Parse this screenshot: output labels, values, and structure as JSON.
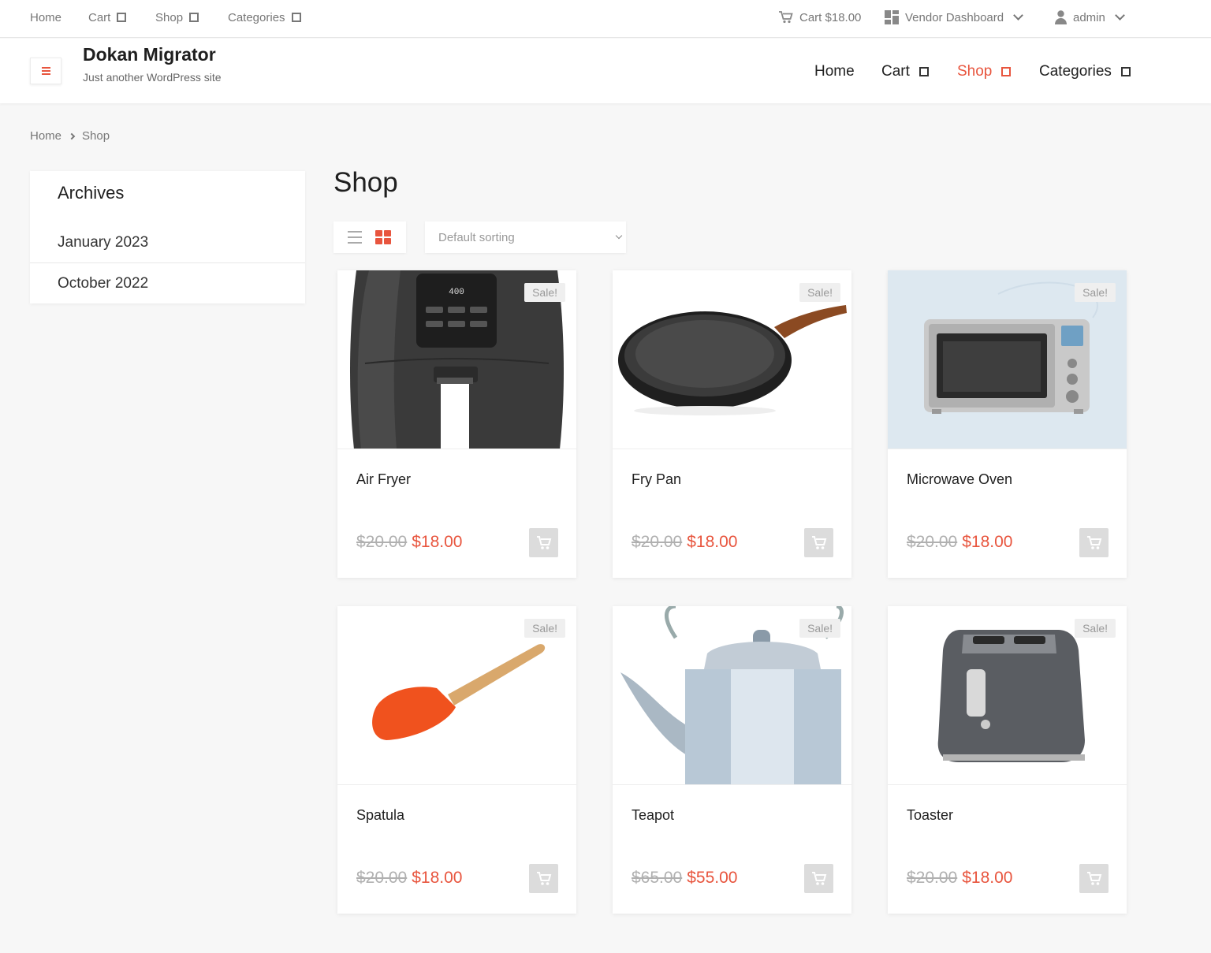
{
  "topbar": {
    "left": [
      {
        "label": "Home"
      },
      {
        "label": "Cart"
      },
      {
        "label": "Shop"
      },
      {
        "label": "Categories"
      }
    ],
    "cart_label": "Cart $18.00",
    "vendor_label": "Vendor Dashboard",
    "user_label": "admin"
  },
  "header": {
    "site_title": "Dokan Migrator",
    "site_description": "Just another WordPress site",
    "nav": [
      {
        "label": "Home"
      },
      {
        "label": "Cart"
      },
      {
        "label": "Shop"
      },
      {
        "label": "Categories"
      }
    ],
    "active_nav": "Shop"
  },
  "breadcrumb": {
    "home": "Home",
    "current": "Shop"
  },
  "sidebar": {
    "title": "Archives",
    "items": [
      {
        "label": "January 2023"
      },
      {
        "label": "October 2022"
      }
    ]
  },
  "main": {
    "title": "Shop",
    "sort_placeholder": "Default sorting"
  },
  "colors": {
    "accent": "#e8553e"
  },
  "products": [
    {
      "name": "Air Fryer",
      "old_price": "$20.00",
      "price": "$18.00",
      "badge": "Sale!"
    },
    {
      "name": "Fry Pan",
      "old_price": "$20.00",
      "price": "$18.00",
      "badge": "Sale!"
    },
    {
      "name": "Microwave Oven",
      "old_price": "$20.00",
      "price": "$18.00",
      "badge": "Sale!"
    },
    {
      "name": "Spatula",
      "old_price": "$20.00",
      "price": "$18.00",
      "badge": "Sale!"
    },
    {
      "name": "Teapot",
      "old_price": "$65.00",
      "price": "$55.00",
      "badge": "Sale!"
    },
    {
      "name": "Toaster",
      "old_price": "$20.00",
      "price": "$18.00",
      "badge": "Sale!"
    }
  ]
}
